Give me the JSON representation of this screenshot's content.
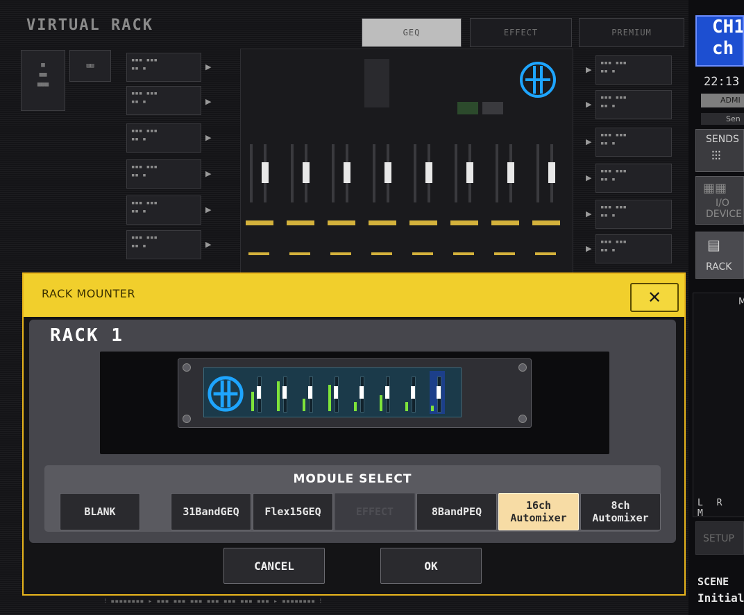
{
  "virtual_rack": {
    "title": "VIRTUAL RACK",
    "tabs": [
      {
        "label": "GEQ",
        "active": true
      },
      {
        "label": "EFFECT",
        "active": false
      },
      {
        "label": "PREMIUM",
        "active": false
      }
    ]
  },
  "right_panel": {
    "channel_line1": "CH1",
    "channel_line2": "ch",
    "time": "22:13",
    "user": "ADMI",
    "sub": "Sen",
    "sends_label": "SENDS",
    "io_label_1": "I/O",
    "io_label_2": "DEVICE",
    "rack_label": "RACK",
    "meter_label": "M",
    "lrm": "L R M",
    "setup_label": "SETUP",
    "scene_label": "SCENE",
    "scene_name": "Initial"
  },
  "dialog": {
    "title": "RACK MOUNTER",
    "close_glyph": "✕",
    "rack_label": "RACK 1",
    "module_select_label": "MODULE SELECT",
    "modules": [
      {
        "label": "BLANK",
        "state": "normal"
      },
      {
        "label": "31BandGEQ",
        "state": "normal"
      },
      {
        "label": "Flex15GEQ",
        "state": "normal"
      },
      {
        "label": "EFFECT",
        "state": "disabled"
      },
      {
        "label": "8BandPEQ",
        "state": "normal"
      },
      {
        "label": "16ch\nAutomixer",
        "state": "selected"
      },
      {
        "label": "8ch\nAutomixer",
        "state": "normal"
      }
    ],
    "cancel_label": "CANCEL",
    "ok_label": "OK",
    "channel_levels": [
      0.55,
      0.85,
      0.35,
      0.75,
      0.25,
      0.45,
      0.25,
      0.15
    ]
  },
  "colors": {
    "dialog_header": "#f1cf2c",
    "dialog_border": "#e8b51c",
    "selected_module": "#f7dca5",
    "channel_box": "#1d4fd1",
    "logo_blue": "#1ea5ff",
    "meter_green": "#7ee33a"
  }
}
